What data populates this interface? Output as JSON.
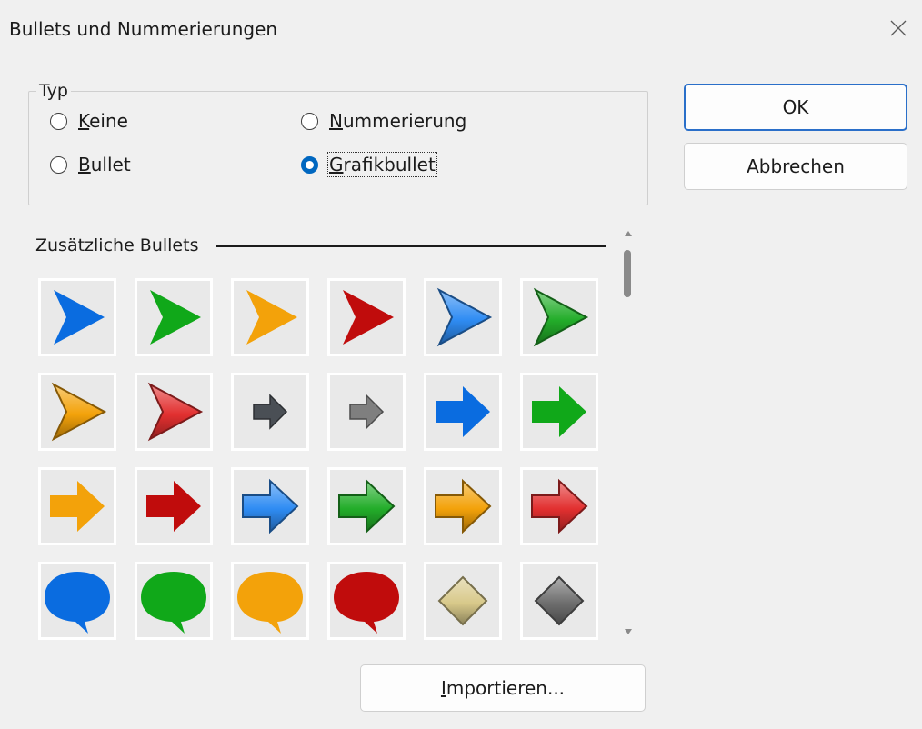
{
  "window": {
    "title": "Bullets und Nummerierungen"
  },
  "typ": {
    "legend": "Typ",
    "options": [
      {
        "id": "keine",
        "hot": "K",
        "rest": "eine",
        "checked": false
      },
      {
        "id": "nummerierung",
        "hot": "N",
        "rest": "ummerierung",
        "checked": false
      },
      {
        "id": "bullet",
        "hot": "B",
        "rest": "ullet",
        "checked": false
      },
      {
        "id": "grafikbullet",
        "hot": "G",
        "rest": "rafikbullet",
        "checked": true
      }
    ]
  },
  "buttons": {
    "ok": "OK",
    "cancel": "Abbrechen",
    "import_hot": "I",
    "import_rest": "mportieren..."
  },
  "bullets_section": {
    "title": "Zusätzliche Bullets"
  },
  "bullets": [
    {
      "shape": "chevron",
      "color": "#0a6ce0",
      "style": "flat"
    },
    {
      "shape": "chevron",
      "color": "#10a819",
      "style": "flat"
    },
    {
      "shape": "chevron",
      "color": "#f3a20a",
      "style": "flat"
    },
    {
      "shape": "chevron",
      "color": "#c00c0c",
      "style": "flat"
    },
    {
      "shape": "chevron",
      "color": "#2f8cf3",
      "style": "glossy"
    },
    {
      "shape": "chevron",
      "color": "#23ad2a",
      "style": "glossy"
    },
    {
      "shape": "chevron",
      "color": "#f3a20a",
      "style": "glossy"
    },
    {
      "shape": "chevron",
      "color": "#e23030",
      "style": "glossy"
    },
    {
      "shape": "arrow-small",
      "color": "#4a4f55",
      "style": "flat"
    },
    {
      "shape": "arrow-small",
      "color": "#7f7f7f",
      "style": "flat"
    },
    {
      "shape": "arrow",
      "color": "#0a6ce0",
      "style": "flat"
    },
    {
      "shape": "arrow",
      "color": "#10a819",
      "style": "flat"
    },
    {
      "shape": "arrow",
      "color": "#f3a20a",
      "style": "flat"
    },
    {
      "shape": "arrow",
      "color": "#c00c0c",
      "style": "flat"
    },
    {
      "shape": "arrow",
      "color": "#2f8cf3",
      "style": "glossy"
    },
    {
      "shape": "arrow",
      "color": "#23ad2a",
      "style": "glossy"
    },
    {
      "shape": "arrow",
      "color": "#f3a20a",
      "style": "glossy"
    },
    {
      "shape": "arrow",
      "color": "#e23030",
      "style": "glossy"
    },
    {
      "shape": "bubble",
      "color": "#0a6ce0",
      "style": "flat"
    },
    {
      "shape": "bubble",
      "color": "#10a819",
      "style": "flat"
    },
    {
      "shape": "bubble",
      "color": "#f3a20a",
      "style": "flat"
    },
    {
      "shape": "bubble",
      "color": "#c00c0c",
      "style": "flat"
    },
    {
      "shape": "diamond",
      "color": "#d8c98a",
      "style": "textured"
    },
    {
      "shape": "diamond",
      "color": "#6e6e6e",
      "style": "glossy"
    }
  ]
}
